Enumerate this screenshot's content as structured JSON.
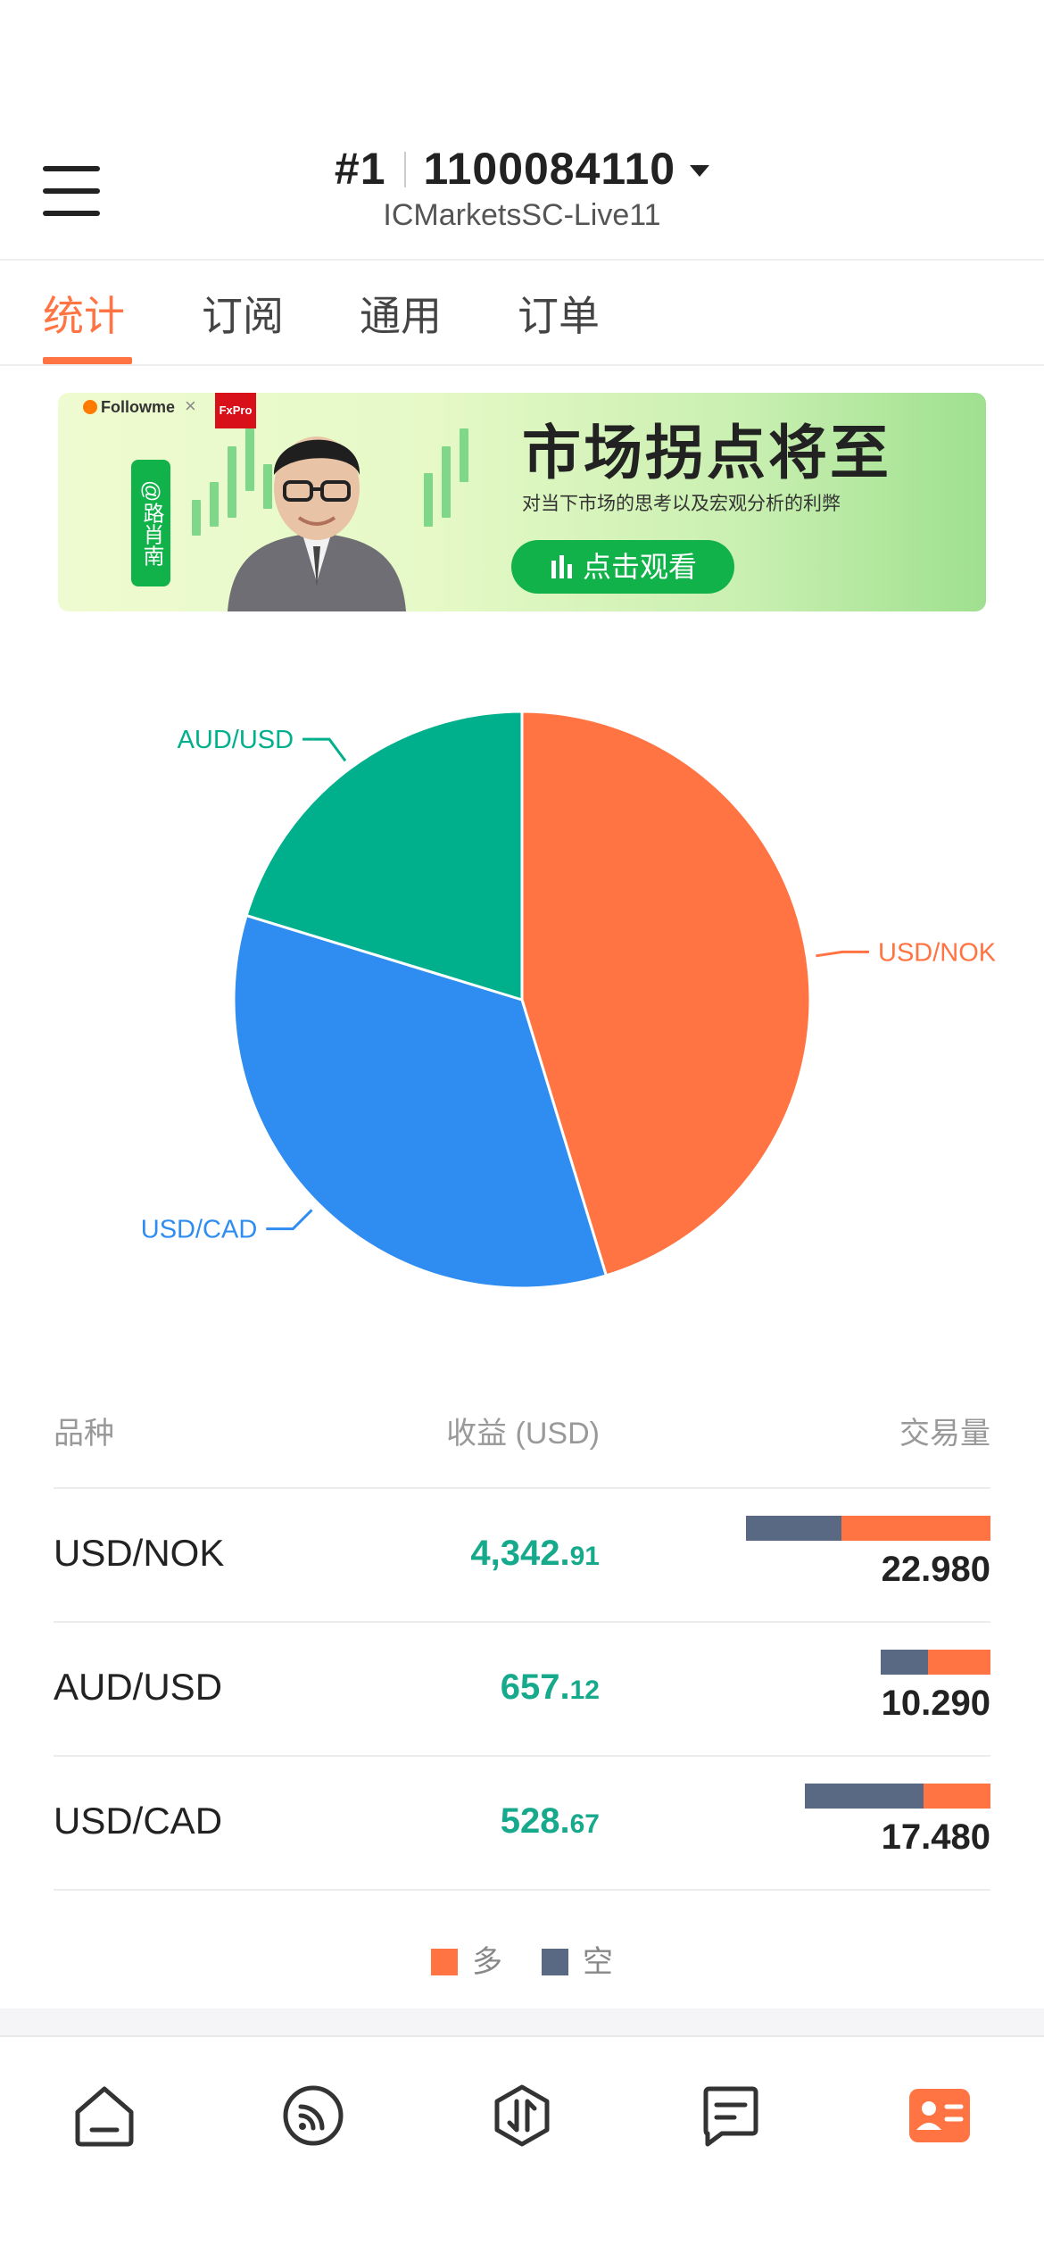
{
  "header": {
    "account_index": "#1",
    "account_number": "1100084110",
    "server": "ICMarketsSC-Live11"
  },
  "tabs": [
    {
      "label": "统计",
      "active": true
    },
    {
      "label": "订阅",
      "active": false
    },
    {
      "label": "通用",
      "active": false
    },
    {
      "label": "订单",
      "active": false
    }
  ],
  "banner": {
    "logo": "Followme",
    "partner": "FxPro",
    "tag": "@路肖南",
    "title": "市场拐点将至",
    "subtitle": "对当下市场的思考以及宏观分析的利弊",
    "cta": "点击观看"
  },
  "chart_data": {
    "type": "pie",
    "slices": [
      {
        "label": "USD/NOK",
        "value": 22.98,
        "color": "#ff7442"
      },
      {
        "label": "USD/CAD",
        "value": 17.48,
        "color": "#2f8cf0"
      },
      {
        "label": "AUD/USD",
        "value": 10.29,
        "color": "#00b08c"
      }
    ]
  },
  "table": {
    "headers": {
      "symbol": "品种",
      "profit": "收益 (USD)",
      "volume": "交易量"
    },
    "rows": [
      {
        "symbol": "USD/NOK",
        "profit_int": "4,342.",
        "profit_dec": "91",
        "volume": "22.980",
        "long_fraction": 0.61
      },
      {
        "symbol": "AUD/USD",
        "profit_int": "657.",
        "profit_dec": "12",
        "volume": "10.290",
        "long_fraction": 0.57
      },
      {
        "symbol": "USD/CAD",
        "profit_int": "528.",
        "profit_dec": "67",
        "volume": "17.480",
        "long_fraction": 0.36
      }
    ]
  },
  "legend": {
    "long": "多",
    "short": "空",
    "long_color": "#ff7442",
    "short_color": "#5a6983"
  },
  "bottom_nav": [
    {
      "icon": "home-icon",
      "active": false
    },
    {
      "icon": "feed-icon",
      "active": false
    },
    {
      "icon": "trade-icon",
      "active": false
    },
    {
      "icon": "message-icon",
      "active": false
    },
    {
      "icon": "profile-card-icon",
      "active": true
    }
  ]
}
